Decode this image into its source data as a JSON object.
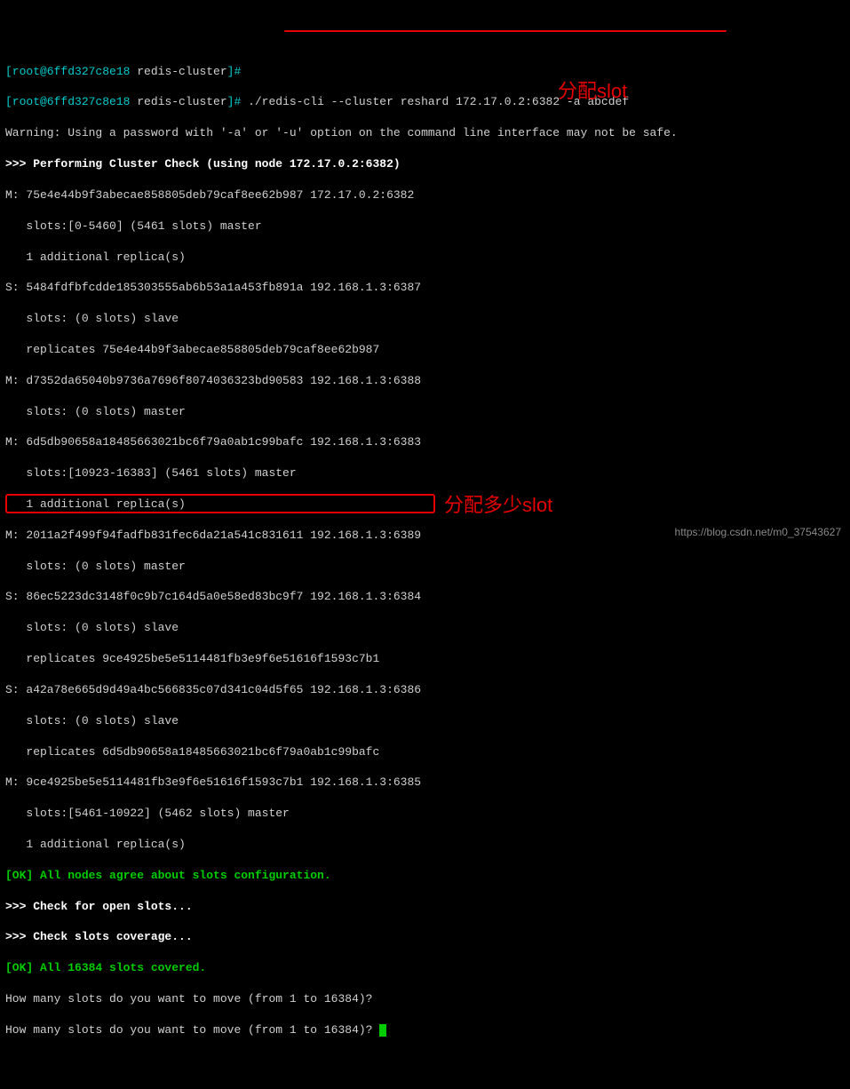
{
  "prompt1": {
    "user_host": "[root@6ffd327c8e18 ",
    "dir": "redis-cluster",
    "end": "]# "
  },
  "prompt2": {
    "user_host": "[root@6ffd327c8e18 ",
    "dir": "redis-cluster",
    "end": "]# ",
    "command": "./redis-cli --cluster reshard 172.17.0.2:6382 -a abcdef"
  },
  "warning": "Warning: Using a password with '-a' or '-u' option on the command line interface may not be safe.",
  "check_header": ">>> Performing Cluster Check (using node 172.17.0.2:6382)",
  "nodes": [
    "M: 75e4e44b9f3abecae858805deb79caf8ee62b987 172.17.0.2:6382",
    "   slots:[0-5460] (5461 slots) master",
    "   1 additional replica(s)",
    "S: 5484fdfbfcdde185303555ab6b53a1a453fb891a 192.168.1.3:6387",
    "   slots: (0 slots) slave",
    "   replicates 75e4e44b9f3abecae858805deb79caf8ee62b987",
    "M: d7352da65040b9736a7696f8074036323bd90583 192.168.1.3:6388",
    "   slots: (0 slots) master",
    "M: 6d5db90658a18485663021bc6f79a0ab1c99bafc 192.168.1.3:6383",
    "   slots:[10923-16383] (5461 slots) master",
    "   1 additional replica(s)",
    "M: 2011a2f499f94fadfb831fec6da21a541c831611 192.168.1.3:6389",
    "   slots: (0 slots) master",
    "S: 86ec5223dc3148f0c9b7c164d5a0e58ed83bc9f7 192.168.1.3:6384",
    "   slots: (0 slots) slave",
    "   replicates 9ce4925be5e5114481fb3e9f6e51616f1593c7b1",
    "S: a42a78e665d9d49a4bc566835c07d341c04d5f65 192.168.1.3:6386",
    "   slots: (0 slots) slave",
    "   replicates 6d5db90658a18485663021bc6f79a0ab1c99bafc",
    "M: 9ce4925be5e5114481fb3e9f6e51616f1593c7b1 192.168.1.3:6385",
    "   slots:[5461-10922] (5462 slots) master",
    "   1 additional replica(s)"
  ],
  "ok1": "[OK] All nodes agree about slots configuration.",
  "check_open": ">>> Check for open slots...",
  "check_cov": ">>> Check slots coverage...",
  "ok2": "[OK] All 16384 slots covered.",
  "question1": "How many slots do you want to move (from 1 to 16384)?",
  "question2": "How many slots do you want to move (from 1 to 16384)? ",
  "annotation1": "分配slot",
  "annotation2": "分配多少slot",
  "watermark": "https://blog.csdn.net/m0_37543627"
}
